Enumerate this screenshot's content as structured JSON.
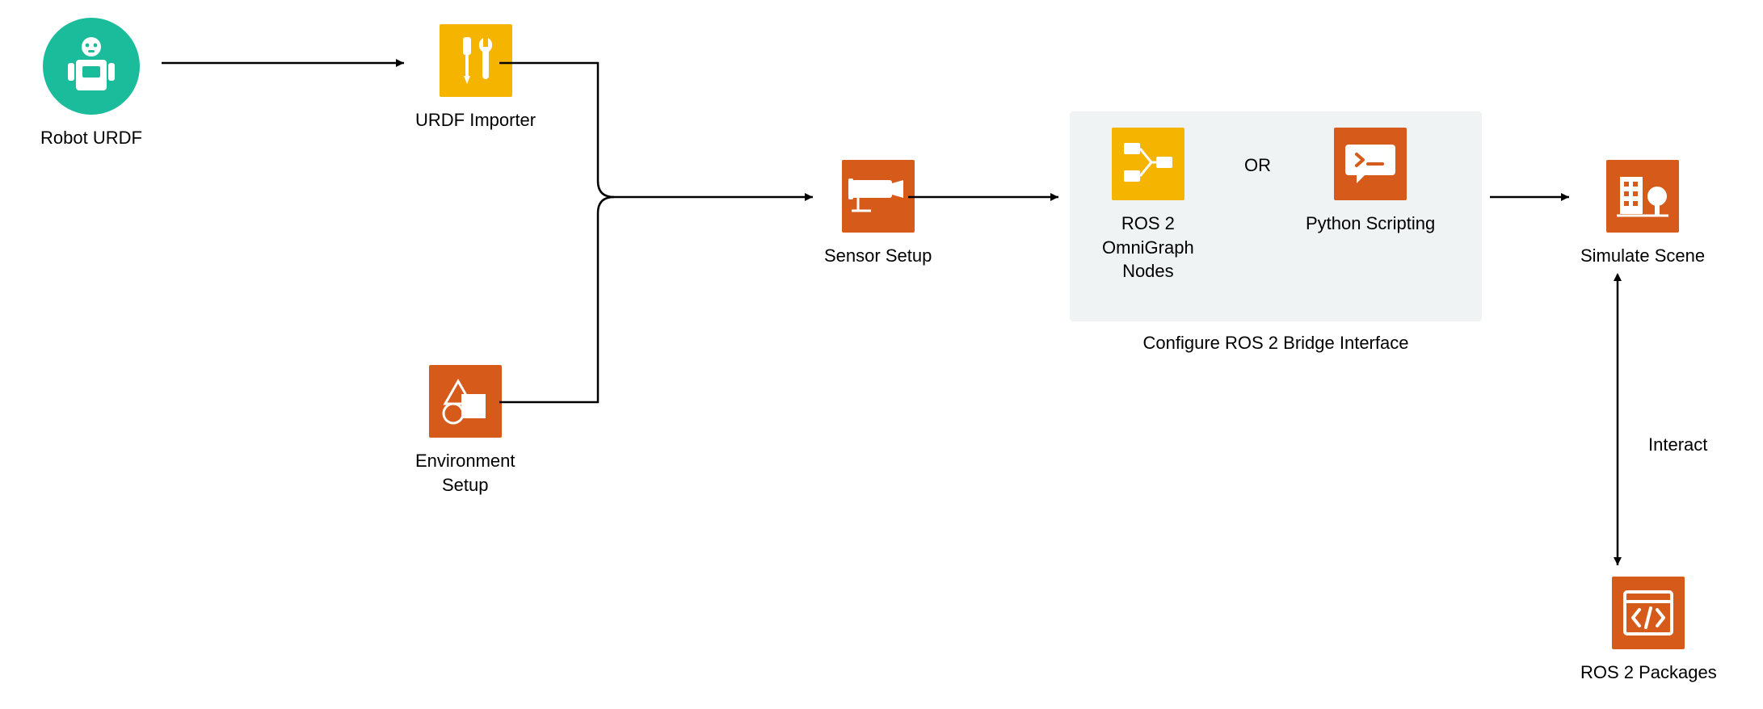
{
  "nodes": {
    "robot_urdf": {
      "label": "Robot URDF"
    },
    "urdf_importer": {
      "label": "URDF Importer"
    },
    "environment_setup": {
      "label": "Environment\nSetup"
    },
    "sensor_setup": {
      "label": "Sensor Setup"
    },
    "ros2_omnigraph": {
      "label": "ROS 2\nOmniGraph\nNodes"
    },
    "python_scripting": {
      "label": "Python Scripting"
    },
    "simulate_scene": {
      "label": "Simulate Scene"
    },
    "ros2_packages": {
      "label": "ROS 2 Packages"
    }
  },
  "group": {
    "bridge_label": "Configure ROS 2 Bridge Interface",
    "or_label": "OR"
  },
  "edges": {
    "interact": "Interact"
  },
  "colors": {
    "orange": "#d65a1a",
    "yellow": "#f5b400",
    "teal": "#1abc9c",
    "group_bg": "#eff3f4"
  }
}
